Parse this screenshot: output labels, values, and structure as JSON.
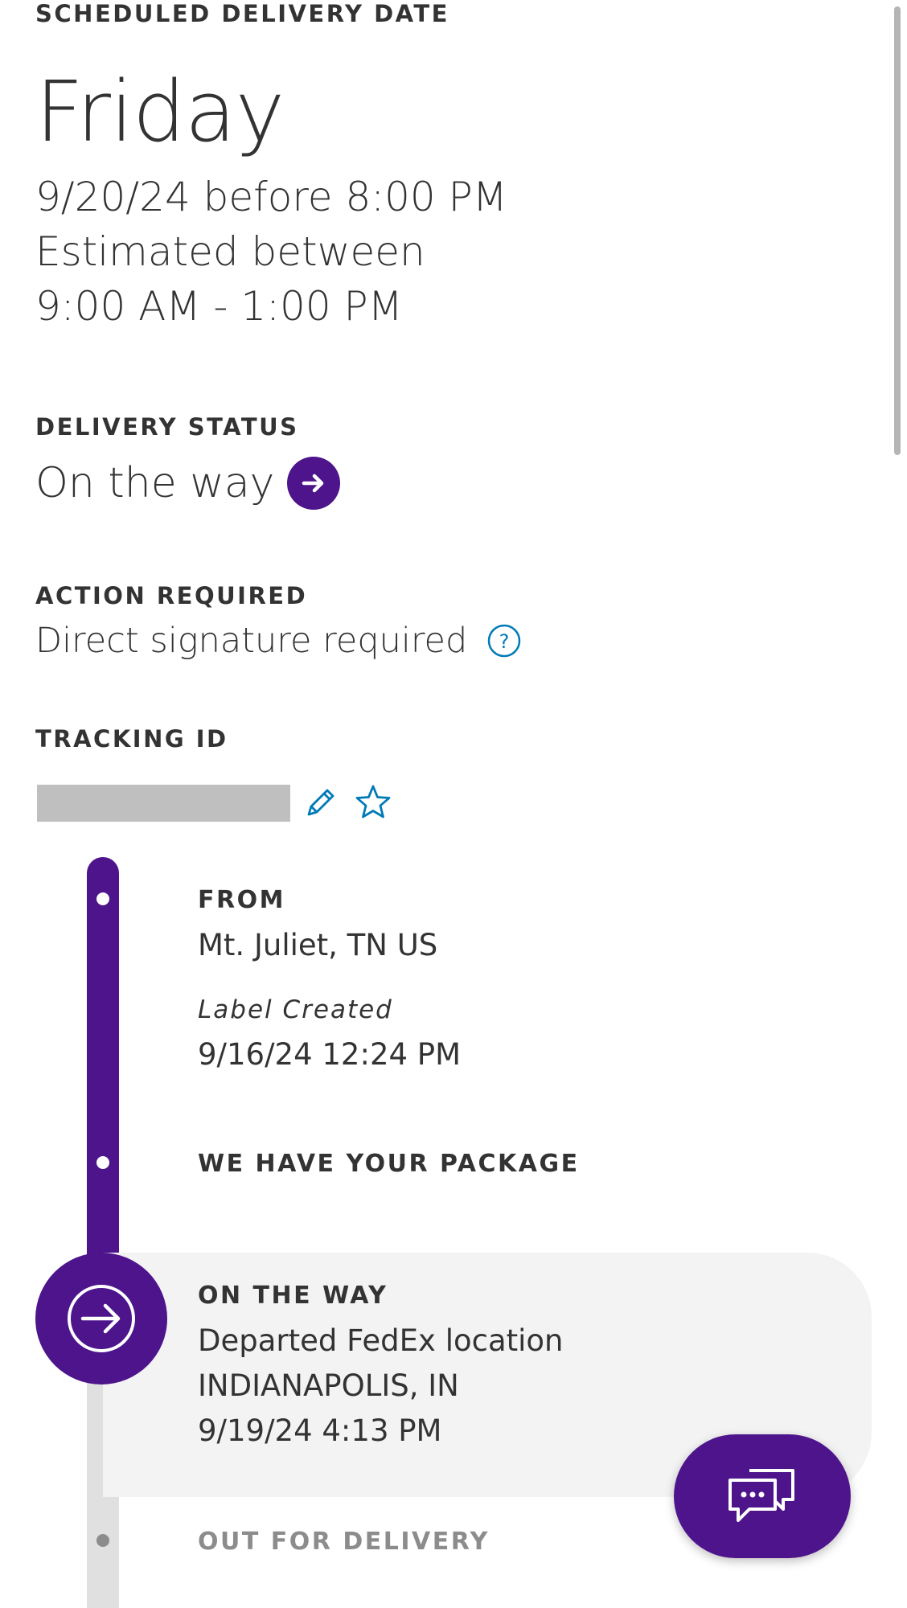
{
  "schedule": {
    "label": "SCHEDULED DELIVERY DATE",
    "day": "Friday",
    "date_line": "9/20/24 before 8:00 PM",
    "estimate_line": "Estimated between",
    "window_line": "9:00 AM - 1:00 PM"
  },
  "status": {
    "label": "DELIVERY STATUS",
    "text": "On the way",
    "icon": "arrow-right-circle-icon"
  },
  "action": {
    "label": "ACTION REQUIRED",
    "text": "Direct signature required",
    "icon": "question-circle-icon"
  },
  "tracking": {
    "label": "TRACKING ID",
    "icons": [
      "pencil-icon",
      "star-outline-icon"
    ]
  },
  "timeline": {
    "from": {
      "title": "FROM",
      "location": "Mt. Juliet, TN US",
      "event": "Label Created",
      "time": "9/16/24 12:24 PM"
    },
    "picked_up": {
      "title": "WE HAVE YOUR PACKAGE"
    },
    "current": {
      "title": "ON THE WAY",
      "line1": "Departed FedEx location",
      "line2": "INDIANAPOLIS, IN",
      "line3": "9/19/24 4:13 PM"
    },
    "next": {
      "title": "OUT FOR DELIVERY"
    }
  },
  "colors": {
    "brand_purple": "#4d148c",
    "text": "#333333",
    "help_blue": "#007ab7",
    "muted": "#8c8c8c",
    "card_bg": "#f3f3f3"
  },
  "chat": {
    "icon": "chat-bubbles-icon"
  }
}
